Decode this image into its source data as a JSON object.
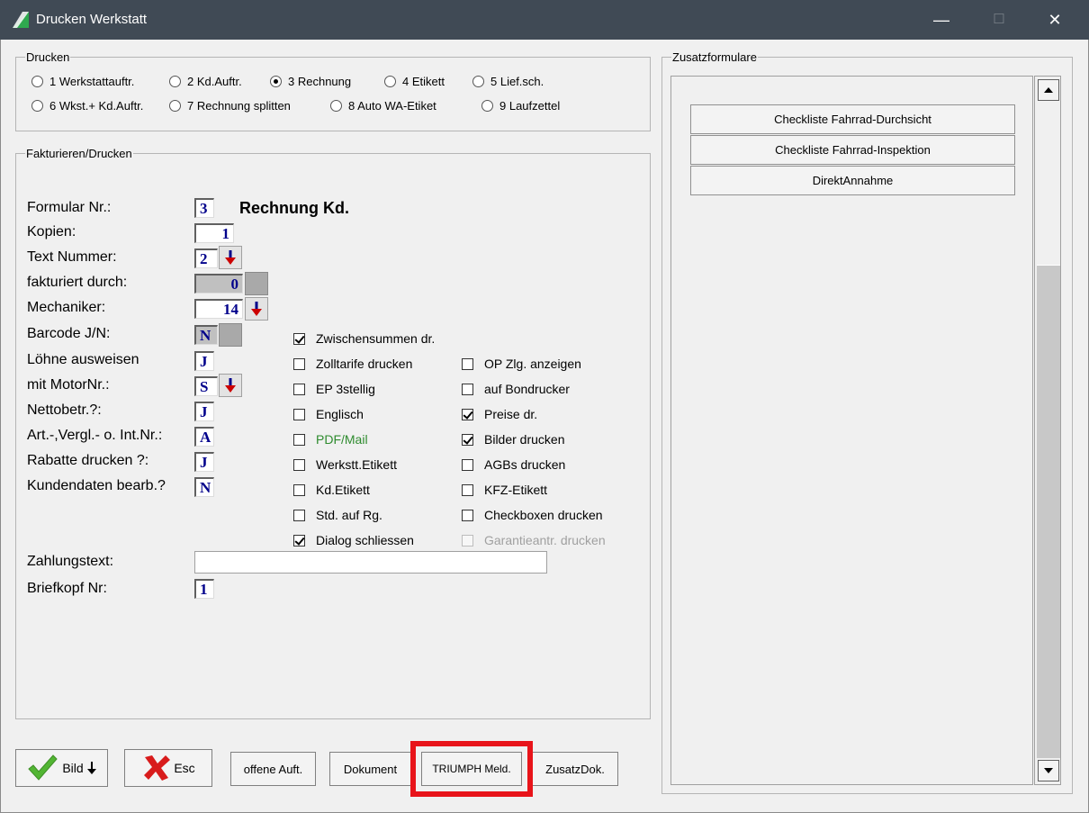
{
  "window": {
    "title": "Drucken Werkstatt",
    "minimize": "—",
    "maximize": "☐",
    "close": "✕"
  },
  "drucken": {
    "legend": "Drucken",
    "options": [
      {
        "label": "1 Werkstattauftr.",
        "selected": false
      },
      {
        "label": "2 Kd.Auftr.",
        "selected": false
      },
      {
        "label": "3 Rechnung",
        "selected": true
      },
      {
        "label": "4 Etikett",
        "selected": false
      },
      {
        "label": "5 Lief.sch.",
        "selected": false
      },
      {
        "label": "6 Wkst.+ Kd.Auftr.",
        "selected": false
      },
      {
        "label": "7 Rechnung splitten",
        "selected": false
      },
      {
        "label": "8 Auto WA-Etiket",
        "selected": false
      },
      {
        "label": "9 Laufzettel",
        "selected": false
      }
    ]
  },
  "fakturieren": {
    "legend": "Fakturieren/Drucken",
    "form_title": "Rechnung Kd.",
    "fields": [
      {
        "label": "Formular Nr.:",
        "value": "3"
      },
      {
        "label": "Kopien:",
        "value": "1"
      },
      {
        "label": "Text Nummer:",
        "value": "2"
      },
      {
        "label": "fakturiert durch:",
        "value": "0"
      },
      {
        "label": "Mechaniker:",
        "value": "14"
      },
      {
        "label": "Barcode J/N:",
        "value": "N"
      },
      {
        "label": "Löhne ausweisen",
        "value": "J"
      },
      {
        "label": "mit MotorNr.:",
        "value": "S"
      },
      {
        "label": "Nettobetr.?:",
        "value": "J"
      },
      {
        "label": "Art.-,Vergl.- o. Int.Nr.:",
        "value": "A"
      },
      {
        "label": "Rabatte drucken ?:",
        "value": "J"
      },
      {
        "label": "Kundendaten bearb.?",
        "value": "N"
      }
    ],
    "zahlungstext": {
      "label": "Zahlungstext:",
      "value": ""
    },
    "briefkopf": {
      "label": "Briefkopf Nr:",
      "value": "1"
    },
    "checkboxes_left": [
      {
        "label": "Zwischensummen dr.",
        "checked": true
      },
      {
        "label": "Zolltarife drucken",
        "checked": false
      },
      {
        "label": "EP 3stellig",
        "checked": false
      },
      {
        "label": "Englisch",
        "checked": false
      },
      {
        "label": "PDF/Mail",
        "checked": false,
        "color": "#2e8b2e"
      },
      {
        "label": "Werkstt.Etikett",
        "checked": false
      },
      {
        "label": "Kd.Etikett",
        "checked": false
      },
      {
        "label": "Std. auf Rg.",
        "checked": false
      },
      {
        "label": "Dialog schliessen",
        "checked": true
      }
    ],
    "checkboxes_right": [
      {
        "label": "OP Zlg. anzeigen",
        "checked": false
      },
      {
        "label": "auf Bondrucker",
        "checked": false
      },
      {
        "label": "Preise dr.",
        "checked": true
      },
      {
        "label": "Bilder drucken",
        "checked": true
      },
      {
        "label": "AGBs drucken",
        "checked": false
      },
      {
        "label": "KFZ-Etikett",
        "checked": false
      },
      {
        "label": "Checkboxen drucken",
        "checked": false
      },
      {
        "label": "Garantieantr. drucken",
        "checked": false,
        "disabled": true
      }
    ]
  },
  "zusatz": {
    "legend": "Zusatzformulare",
    "buttons": [
      "Checkliste Fahrrad-Durchsicht",
      "Checkliste Fahrrad-Inspektion",
      "DirektAnnahme"
    ]
  },
  "bottom_buttons": {
    "bild": "Bild",
    "esc": "Esc",
    "offene": "offene Auft.",
    "dokument": "Dokument",
    "triumph": "TRIUMPH Meld.",
    "zusatzdok": "ZusatzDok."
  }
}
